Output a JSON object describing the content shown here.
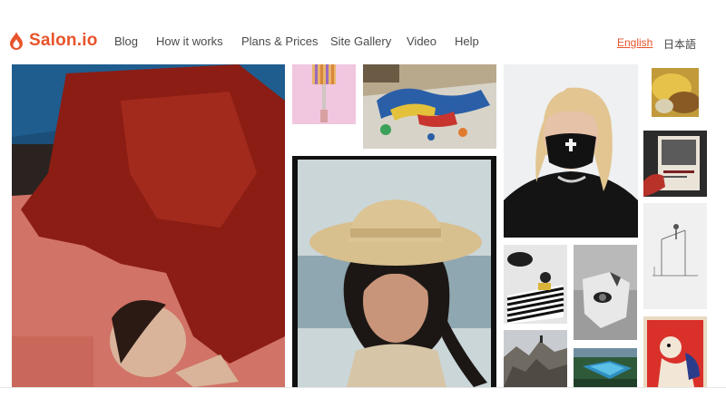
{
  "brand": {
    "name": "Salon.io",
    "icon": "flame-drop-icon",
    "accent": "#e8542b"
  },
  "nav": {
    "items": [
      {
        "label": "Blog"
      },
      {
        "label": "How it works"
      },
      {
        "label": "Plans & Prices"
      },
      {
        "label": "Site Gallery"
      },
      {
        "label": "Video"
      },
      {
        "label": "Help"
      }
    ]
  },
  "language": {
    "english": "English",
    "japanese": "日本語",
    "active": "English"
  },
  "gallery": {
    "tiles": [
      {
        "subject": "man in red sweater lying on pink floor"
      },
      {
        "subject": "paint roller on pink background"
      },
      {
        "subject": "painted body on canvas"
      },
      {
        "subject": "woman in straw hat"
      },
      {
        "subject": "woman wearing black face mask"
      },
      {
        "subject": "blurred yellow abstract"
      },
      {
        "subject": "hand holding a book"
      },
      {
        "subject": "figure on a ladder sketch"
      },
      {
        "subject": "illustration of figure at striped table"
      },
      {
        "subject": "surreal torn paper face"
      },
      {
        "subject": "rocky landscape"
      },
      {
        "subject": "pool in landscape"
      },
      {
        "subject": "red poster illustration"
      }
    ]
  }
}
